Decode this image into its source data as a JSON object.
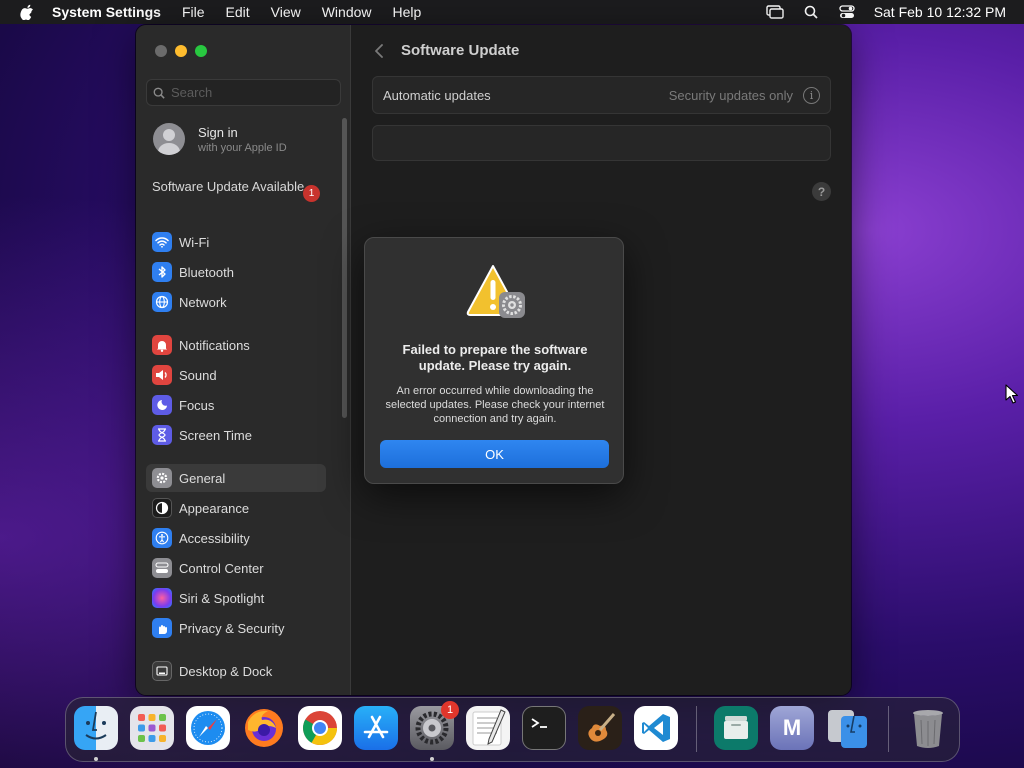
{
  "menubar": {
    "app_name": "System Settings",
    "menus": [
      "File",
      "Edit",
      "View",
      "Window",
      "Help"
    ],
    "clock": "Sat Feb 10  12:32 PM"
  },
  "sidebar": {
    "search_placeholder": "Search",
    "signin_title": "Sign in",
    "signin_subtitle": "with your Apple ID",
    "update_label": "Software Update Available",
    "update_badge": "1",
    "items": [
      {
        "label": "Wi-Fi",
        "icon": "wifi-icon",
        "color": "#2f7ff0"
      },
      {
        "label": "Bluetooth",
        "icon": "bluetooth-icon",
        "color": "#2f7ff0"
      },
      {
        "label": "Network",
        "icon": "network-icon",
        "color": "#2f7ff0"
      },
      {
        "label": "Notifications",
        "icon": "notifications-icon",
        "color": "#e0453f"
      },
      {
        "label": "Sound",
        "icon": "sound-icon",
        "color": "#e0453f"
      },
      {
        "label": "Focus",
        "icon": "focus-icon",
        "color": "#5e5ce6"
      },
      {
        "label": "Screen Time",
        "icon": "screen-time-icon",
        "color": "#5e5ce6"
      },
      {
        "label": "General",
        "icon": "general-icon",
        "color": "#8e8e93"
      },
      {
        "label": "Appearance",
        "icon": "appearance-icon",
        "color": "#1c1c1c"
      },
      {
        "label": "Accessibility",
        "icon": "accessibility-icon",
        "color": "#2f7ff0"
      },
      {
        "label": "Control Center",
        "icon": "control-center-icon",
        "color": "#8e8e93"
      },
      {
        "label": "Siri & Spotlight",
        "icon": "siri-icon",
        "color": "#b54ad8"
      },
      {
        "label": "Privacy & Security",
        "icon": "privacy-icon",
        "color": "#2f7ff0"
      },
      {
        "label": "Desktop & Dock",
        "icon": "desktop-dock-icon",
        "color": "#3a3a3a"
      }
    ],
    "selected": "General"
  },
  "main": {
    "title": "Software Update",
    "automatic_updates_label": "Automatic updates",
    "automatic_updates_value": "Security updates only",
    "help_label": "?"
  },
  "dialog": {
    "title": "Failed to prepare the software update. Please try again.",
    "message": "An error occurred while downloading the selected updates. Please check your internet connection and try again.",
    "ok_label": "OK"
  },
  "dock": {
    "apps": [
      {
        "name": "Finder",
        "icon": "finder-icon",
        "running": true
      },
      {
        "name": "Launchpad",
        "icon": "launchpad-icon",
        "running": false
      },
      {
        "name": "Safari",
        "icon": "safari-icon",
        "running": false
      },
      {
        "name": "Firefox",
        "icon": "firefox-icon",
        "running": false
      },
      {
        "name": "Chrome",
        "icon": "chrome-icon",
        "running": false
      },
      {
        "name": "App Store",
        "icon": "app-store-icon",
        "running": false
      },
      {
        "name": "System Settings",
        "icon": "system-settings-icon",
        "running": true,
        "badge": "1"
      },
      {
        "name": "TextEdit",
        "icon": "textedit-icon",
        "running": false
      },
      {
        "name": "Terminal",
        "icon": "terminal-icon",
        "running": false
      },
      {
        "name": "GarageBand",
        "icon": "garageband-icon",
        "running": false
      },
      {
        "name": "Visual Studio Code",
        "icon": "vscode-icon",
        "running": false
      },
      {
        "name": "Files",
        "icon": "files-icon",
        "running": false
      },
      {
        "name": "M app",
        "icon": "m-app-icon",
        "running": false,
        "letter": "M"
      },
      {
        "name": "Migration Assistant",
        "icon": "migration-icon",
        "running": false
      },
      {
        "name": "Trash",
        "icon": "trash-icon",
        "running": false
      }
    ]
  }
}
